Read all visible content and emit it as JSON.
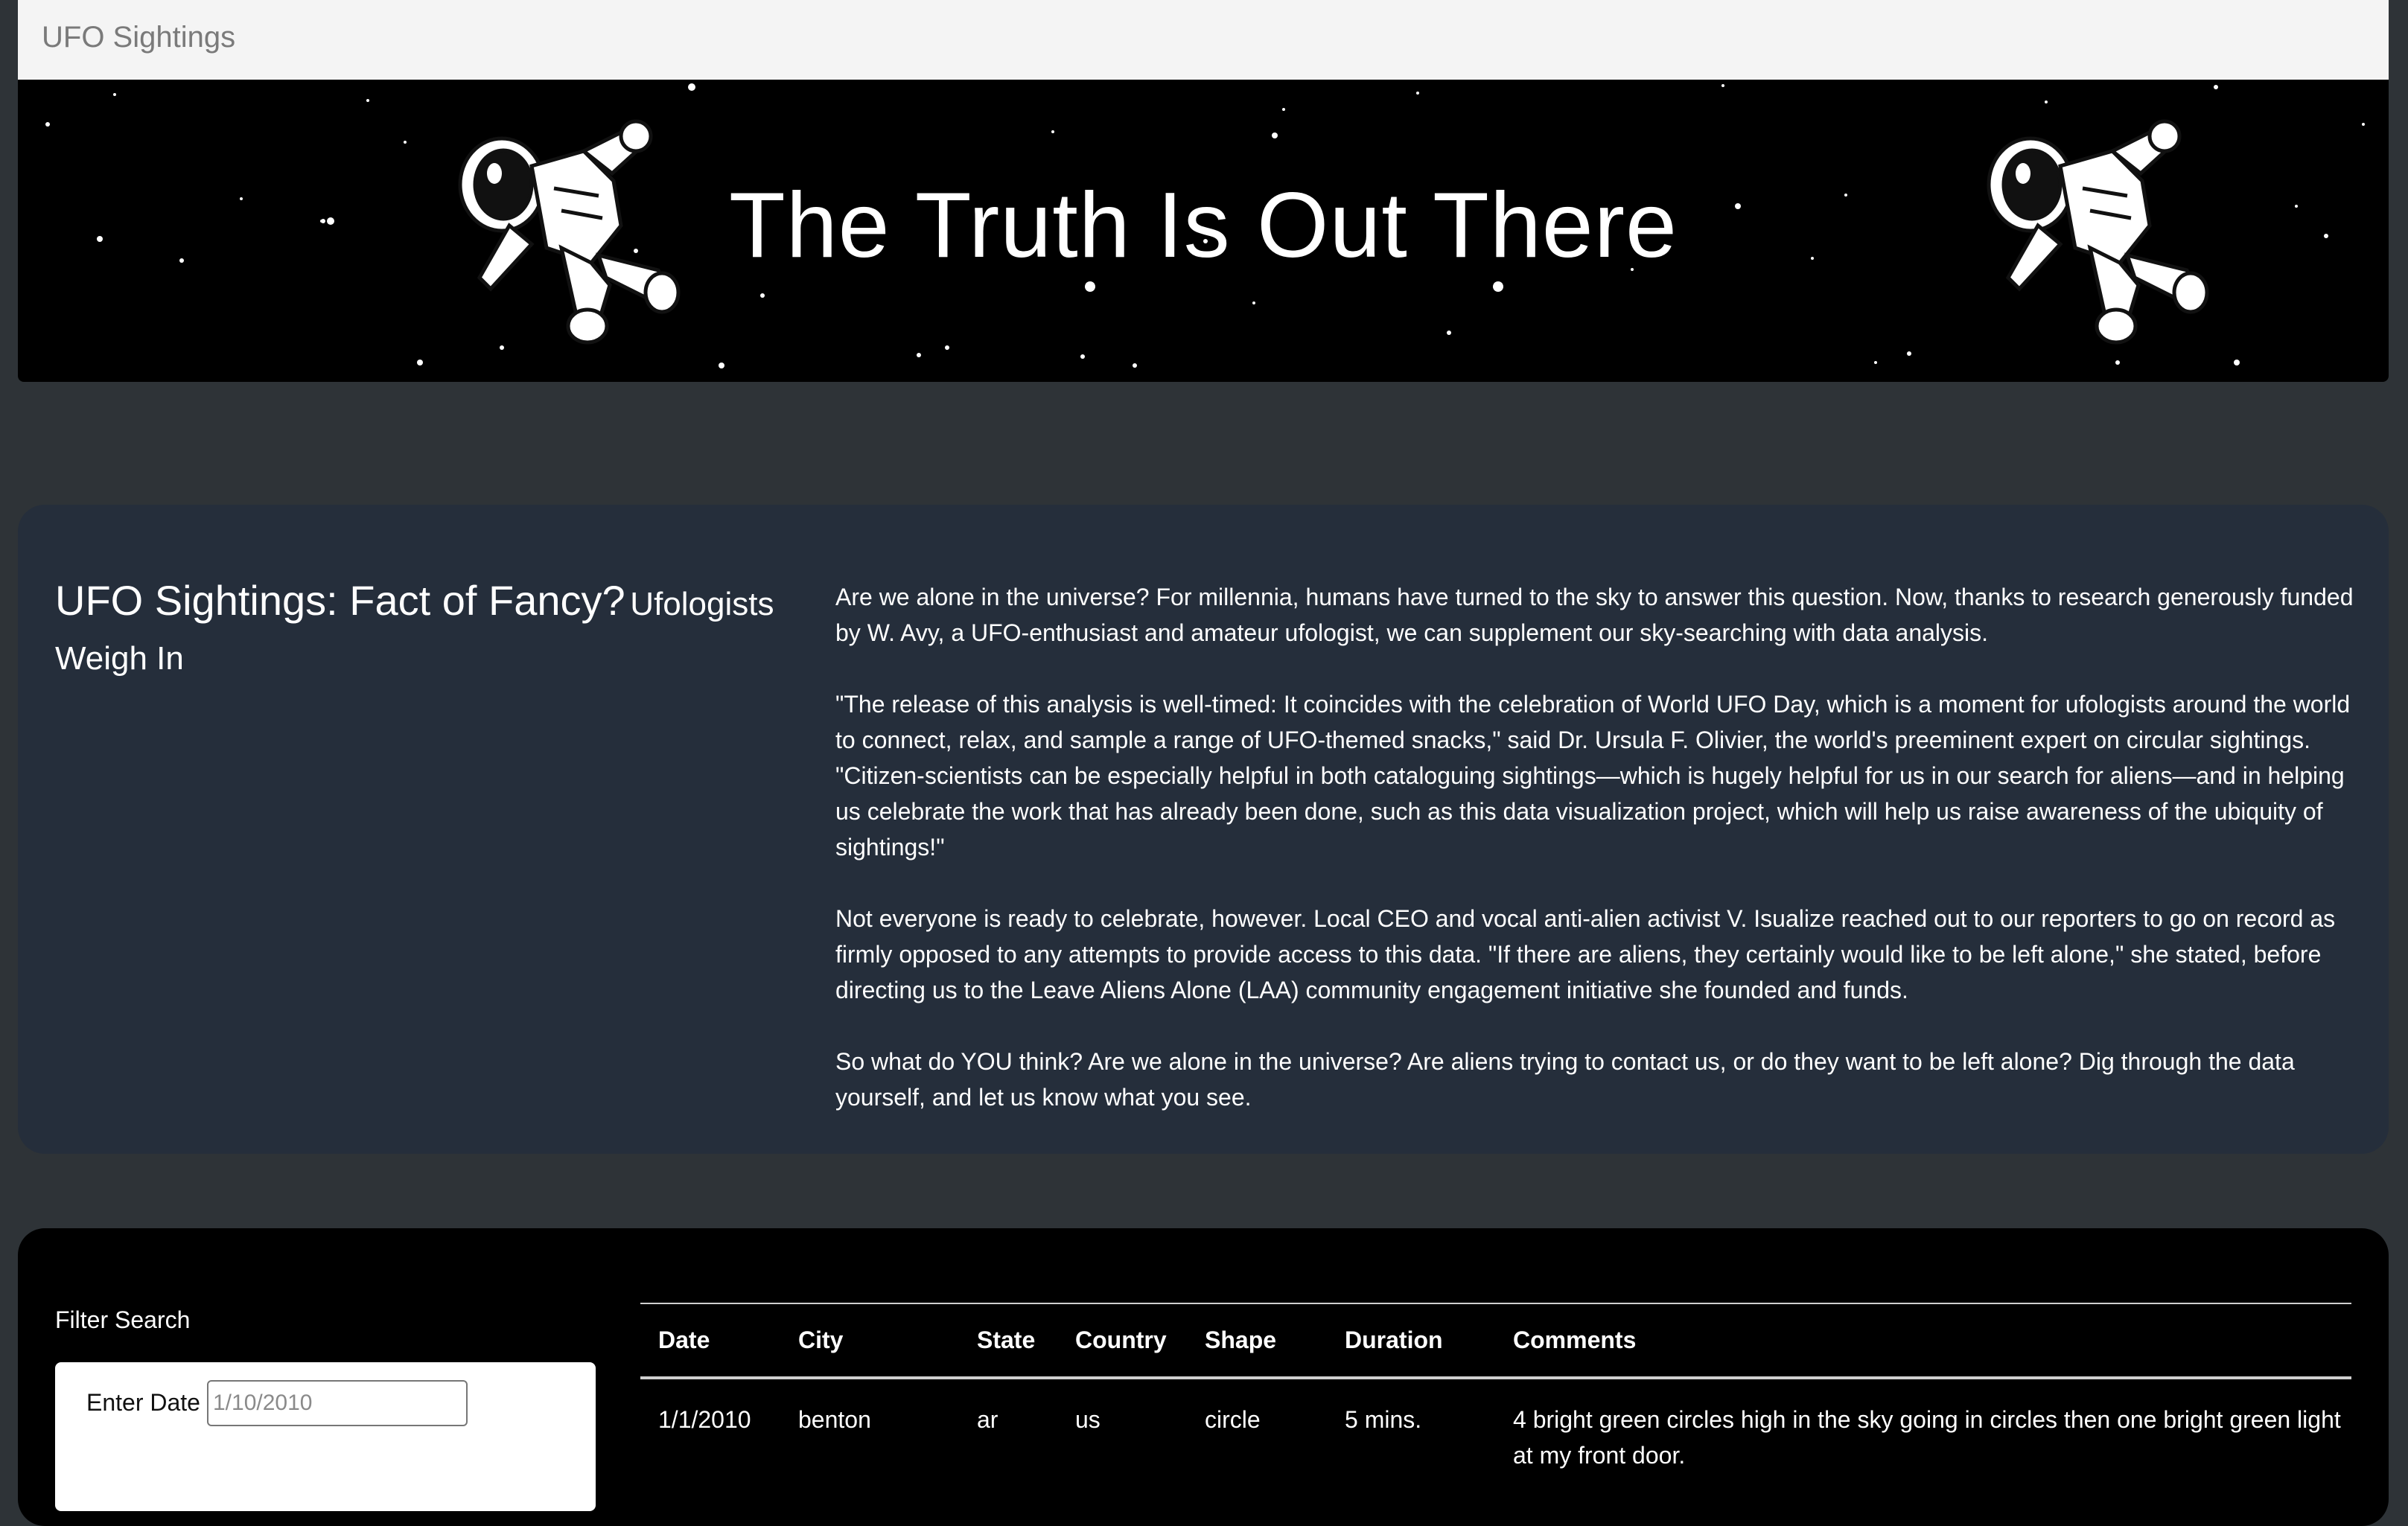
{
  "navbar": {
    "brand": "UFO Sightings"
  },
  "hero": {
    "title": "The Truth Is Out There"
  },
  "article": {
    "headline_main": "UFO Sightings: Fact of Fancy?",
    "headline_sub": "Ufologists Weigh In",
    "paragraphs": [
      "Are we alone in the universe? For millennia, humans have turned to the sky to answer this question. Now, thanks to research generously funded by W. Avy, a UFO-enthusiast and amateur ufologist, we can supplement our sky-searching with data analysis.",
      "\"The release of this analysis is well-timed: It coincides with the celebration of World UFO Day, which is a moment for ufologists around the world to connect, relax, and sample a range of UFO-themed snacks,\" said Dr. Ursula F. Olivier, the world's preeminent expert on circular sightings. \"Citizen-scientists can be especially helpful in both cataloguing sightings—which is hugely helpful for us in our search for aliens—and in helping us celebrate the work that has already been done, such as this data visualization project, which will help us raise awareness of the ubiquity of sightings!\"",
      "Not everyone is ready to celebrate, however. Local CEO and vocal anti-alien activist V. Isualize reached out to our reporters to go on record as firmly opposed to any attempts to provide access to this data. \"If there are aliens, they certainly would like to be left alone,\" she stated, before directing us to the Leave Aliens Alone (LAA) community engagement initiative she founded and funds.",
      "So what do YOU think? Are we alone in the universe? Are aliens trying to contact us, or do they want to be left alone? Dig through the data yourself, and let us know what you see."
    ]
  },
  "filter": {
    "title": "Filter Search",
    "date_label": "Enter Date",
    "date_placeholder": "1/10/2010"
  },
  "table": {
    "headers": [
      "Date",
      "City",
      "State",
      "Country",
      "Shape",
      "Duration",
      "Comments"
    ],
    "rows": [
      [
        "1/1/2010",
        "benton",
        "ar",
        "us",
        "circle",
        "5 mins.",
        "4 bright green circles high in the sky going in circles then one bright green light at my front door."
      ]
    ]
  }
}
